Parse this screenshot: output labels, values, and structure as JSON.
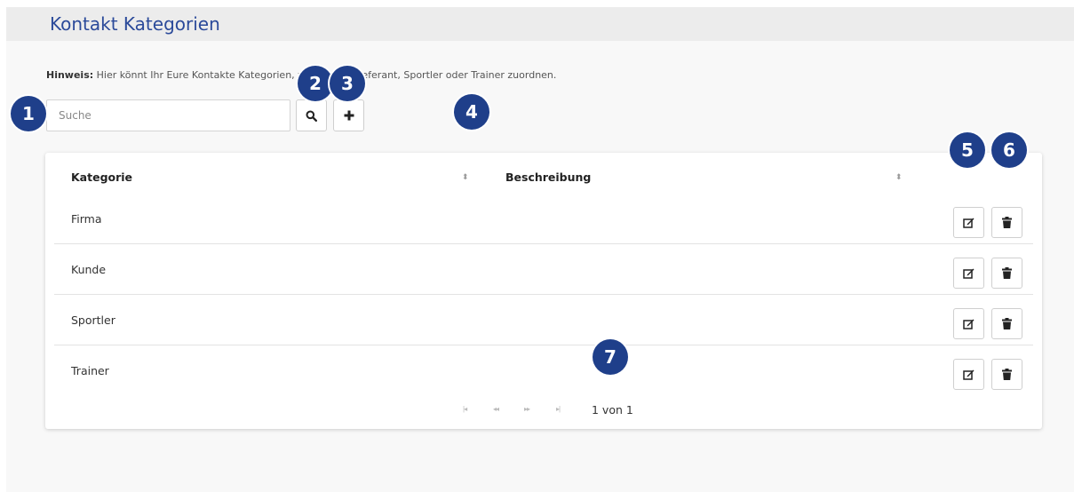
{
  "header": {
    "title": "Kontakt Kategorien"
  },
  "hint": {
    "label": "Hinweis:",
    "text_before": " Hier könnt Ihr Eure Kontakte Kategorien, wi",
    "text_after": "Lieferant, Sportler oder Trainer zuordnen."
  },
  "search": {
    "placeholder": "Suche",
    "value": ""
  },
  "toolbar": {
    "search_icon": "search-icon",
    "add_icon": "plus-icon"
  },
  "table": {
    "columns": [
      "Kategorie",
      "Beschreibung"
    ],
    "rows": [
      {
        "kategorie": "Firma",
        "beschreibung": ""
      },
      {
        "kategorie": "Kunde",
        "beschreibung": ""
      },
      {
        "kategorie": "Sportler",
        "beschreibung": ""
      },
      {
        "kategorie": "Trainer",
        "beschreibung": ""
      }
    ],
    "row_actions": [
      "edit-icon",
      "trash-icon"
    ]
  },
  "pagination": {
    "info": "1 von 1",
    "first": "|◂",
    "prev": "◂◂",
    "next": "▸▸",
    "last": "▸|"
  },
  "annotations": [
    "1",
    "2",
    "3",
    "4",
    "5",
    "6",
    "7"
  ],
  "colors": {
    "accent": "#2b4a9a",
    "badge": "#1f3f8a",
    "header_bg": "#ececec",
    "page_bg": "#f8f8f8"
  }
}
